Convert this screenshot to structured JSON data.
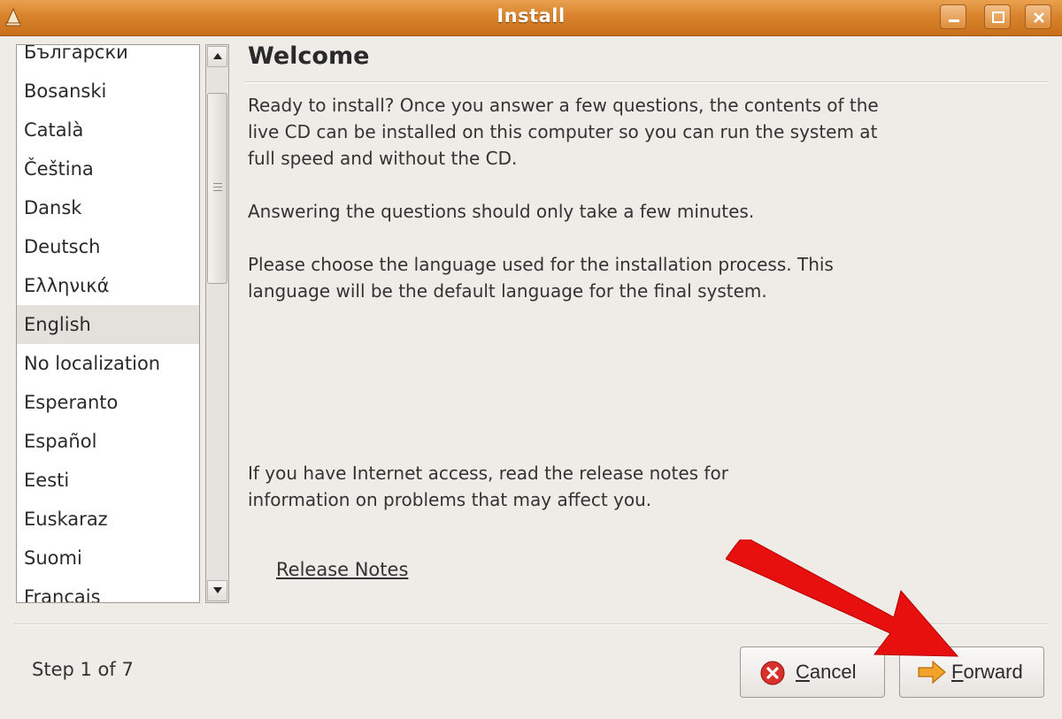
{
  "window": {
    "title": "Install"
  },
  "languages": [
    {
      "label": "Български",
      "selected": false
    },
    {
      "label": "Bosanski",
      "selected": false
    },
    {
      "label": "Català",
      "selected": false
    },
    {
      "label": "Čeština",
      "selected": false
    },
    {
      "label": "Dansk",
      "selected": false
    },
    {
      "label": "Deutsch",
      "selected": false
    },
    {
      "label": "Ελληνικά",
      "selected": false
    },
    {
      "label": "English",
      "selected": true
    },
    {
      "label": "No localization",
      "selected": false
    },
    {
      "label": "Esperanto",
      "selected": false
    },
    {
      "label": "Español",
      "selected": false
    },
    {
      "label": "Eesti",
      "selected": false
    },
    {
      "label": "Euskaraz",
      "selected": false
    },
    {
      "label": "Suomi",
      "selected": false
    },
    {
      "label": "Français",
      "selected": false
    }
  ],
  "content": {
    "heading": "Welcome",
    "para1": "Ready to install? Once you answer a few questions, the contents of the live CD can be installed on this computer so you can run the system at full speed and without the CD.",
    "para2": "Answering the questions should only take a few minutes.",
    "para3": "Please choose the language used for the installation process. This language will be the default language for the final system.",
    "para4": "If you have Internet access, read the release notes for information on problems that may affect you.",
    "release_notes_link": "Release Notes"
  },
  "footer": {
    "step": "Step 1 of 7",
    "cancel_label": "Cancel",
    "forward_label": "Forward"
  },
  "icons": {
    "app": "installer-icon",
    "cancel": "cancel-icon",
    "forward": "forward-arrow-icon"
  },
  "colors": {
    "titlebar": "#d9832c",
    "background": "#efebe7",
    "annotation": "#e8100f"
  }
}
